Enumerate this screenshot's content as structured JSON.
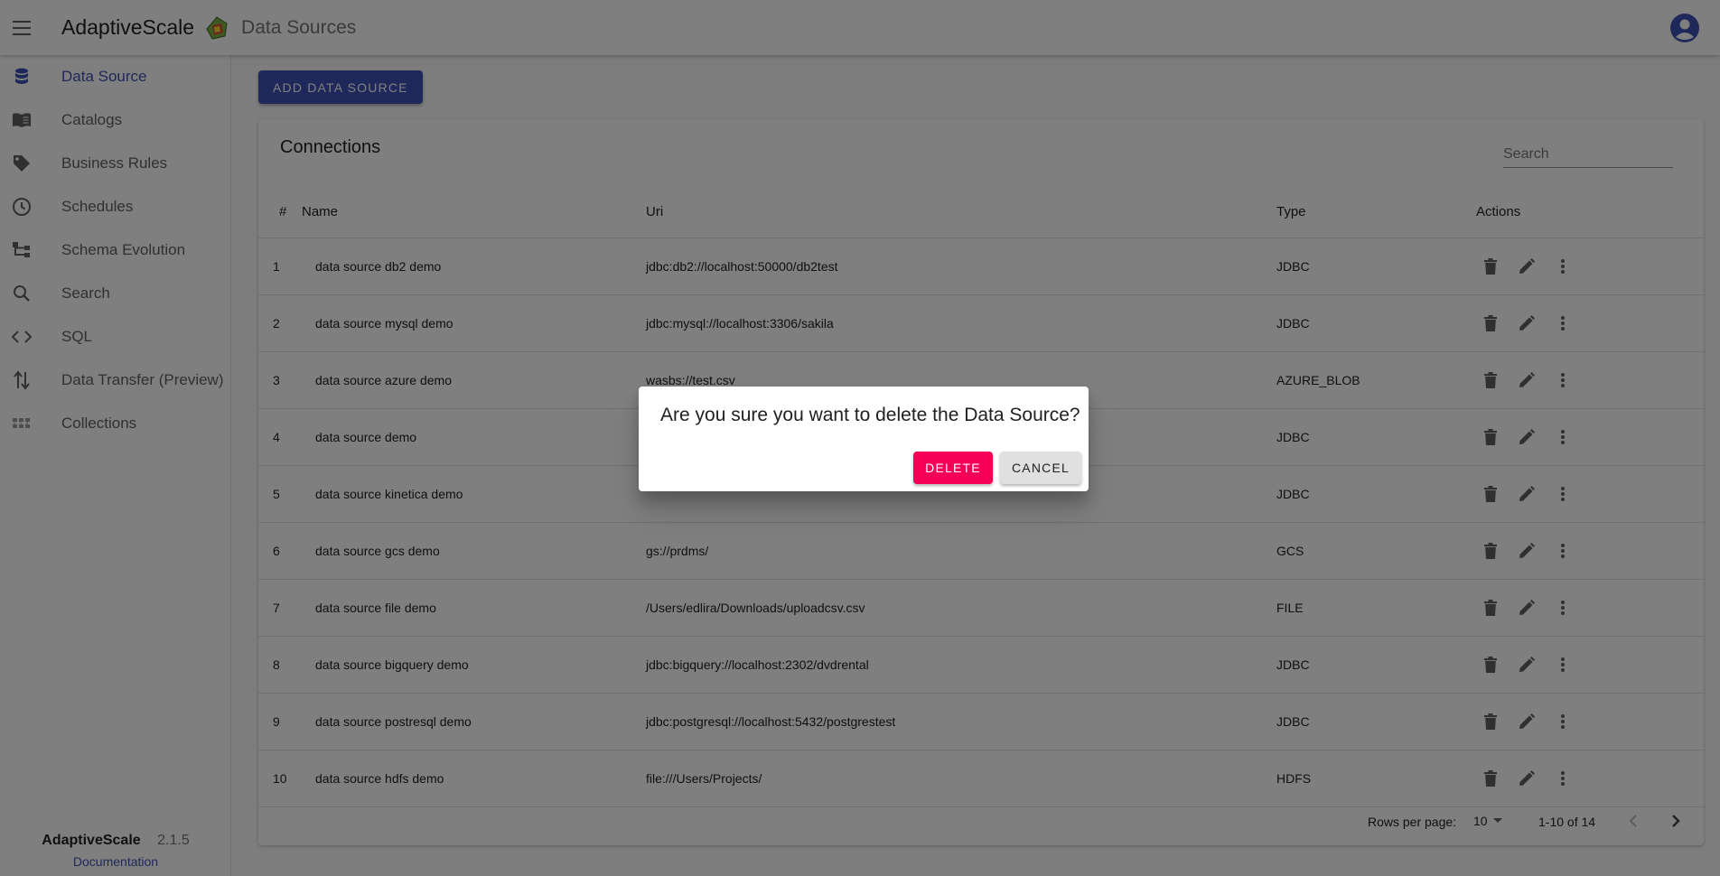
{
  "appbar": {
    "brand": "AdaptiveScale",
    "page_title": "Data Sources"
  },
  "sidebar": {
    "items": [
      {
        "label": "Data Source",
        "icon": "database-icon",
        "active": true
      },
      {
        "label": "Catalogs",
        "icon": "book-open-icon",
        "active": false
      },
      {
        "label": "Business Rules",
        "icon": "tag-icon",
        "active": false
      },
      {
        "label": "Schedules",
        "icon": "clock-icon",
        "active": false
      },
      {
        "label": "Schema Evolution",
        "icon": "tree-icon",
        "active": false
      },
      {
        "label": "Search",
        "icon": "search-icon",
        "active": false
      },
      {
        "label": "SQL",
        "icon": "code-icon",
        "active": false
      },
      {
        "label": "Data Transfer (Preview)",
        "icon": "transfer-icon",
        "active": false
      },
      {
        "label": "Collections",
        "icon": "collections-icon",
        "active": false
      }
    ],
    "footer": {
      "name": "AdaptiveScale",
      "version": "2.1.5",
      "doc_link": "Documentation"
    }
  },
  "main": {
    "add_button": "ADD DATA SOURCE",
    "card_title": "Connections",
    "search_placeholder": "Search",
    "columns": [
      "#",
      "Name",
      "Uri",
      "Type",
      "Actions"
    ],
    "rows": [
      {
        "num": "1",
        "name": "data source db2 demo",
        "uri": "jdbc:db2://localhost:50000/db2test",
        "type": "JDBC"
      },
      {
        "num": "2",
        "name": "data source mysql demo",
        "uri": "jdbc:mysql://localhost:3306/sakila",
        "type": "JDBC"
      },
      {
        "num": "3",
        "name": "data source azure demo",
        "uri": "wasbs://test.csv",
        "type": "AZURE_BLOB"
      },
      {
        "num": "4",
        "name": "data source demo",
        "uri": "",
        "type": "JDBC"
      },
      {
        "num": "5",
        "name": "data source kinetica demo",
        "uri": "",
        "type": "JDBC"
      },
      {
        "num": "6",
        "name": "data source gcs demo",
        "uri": "gs://prdms/",
        "type": "GCS"
      },
      {
        "num": "7",
        "name": "data source file demo",
        "uri": "/Users/edlira/Downloads/uploadcsv.csv",
        "type": "FILE"
      },
      {
        "num": "8",
        "name": "data source bigquery demo",
        "uri": "jdbc:bigquery://localhost:2302/dvdrental",
        "type": "JDBC"
      },
      {
        "num": "9",
        "name": "data source postresql demo",
        "uri": "jdbc:postgresql://localhost:5432/postgrestest",
        "type": "JDBC"
      },
      {
        "num": "10",
        "name": "data source hdfs demo",
        "uri": "file:///Users/Projects/",
        "type": "HDFS"
      }
    ],
    "pagination": {
      "rows_per_page_label": "Rows per page:",
      "rows_per_page_value": "10",
      "range": "1-10 of 14"
    }
  },
  "dialog": {
    "message": "Are you sure you want to delete the Data Source?",
    "delete_label": "DELETE",
    "cancel_label": "CANCEL"
  },
  "colors": {
    "primary": "#3f51b5",
    "danger": "#f50057"
  }
}
